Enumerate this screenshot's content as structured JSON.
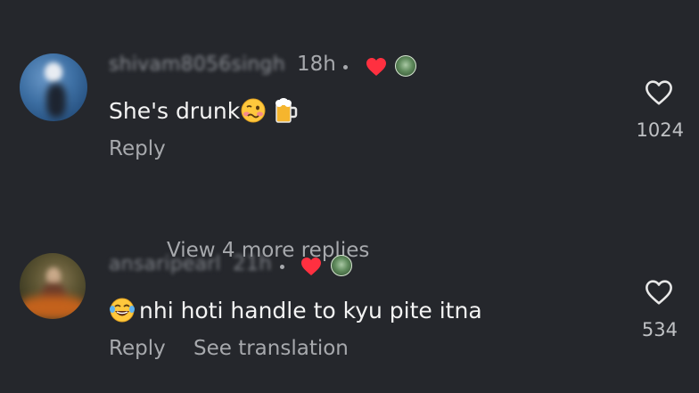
{
  "comments": [
    {
      "username": "shivam8056singh",
      "time": "18h",
      "text": "She's drunk",
      "emojis": [
        "woozy-face",
        "beer-mug"
      ],
      "reply_label": "Reply",
      "like_count": "1024",
      "liked_by_author": true
    },
    {
      "username": "ansaripearl",
      "time": "21h",
      "text": "nhi hoti handle to kyu pite itna",
      "emojis": [
        "face-with-tears-of-joy"
      ],
      "reply_label": "Reply",
      "translation_label": "See translation",
      "like_count": "534",
      "liked_by_author": true
    }
  ],
  "view_replies_label": "View 4 more replies",
  "colors": {
    "background": "#25272c",
    "text_primary": "#f4f4f4",
    "text_secondary": "#a7a9ad",
    "heart_red": "#ff3040"
  }
}
